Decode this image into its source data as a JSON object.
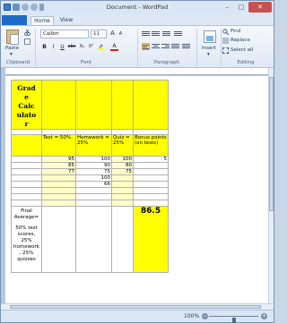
{
  "window": {
    "title": "Document - WordPad",
    "controls": {
      "minimize": "–",
      "maximize": "□",
      "close": "✕"
    }
  },
  "ribbon": {
    "tabs": {
      "file": "",
      "home": "Home",
      "view": "View"
    },
    "clipboard": {
      "paste": "Paste",
      "group": "Clipboard"
    },
    "font": {
      "family": "Calibri",
      "size": "11",
      "bold": "B",
      "italic": "I",
      "underline": "U",
      "strike": "abc",
      "sub": "X₂",
      "sup": "X²",
      "group": "Font",
      "grow": "A",
      "shrink": "A"
    },
    "paragraph": {
      "group": "Paragraph"
    },
    "insert": {
      "label": "Insert"
    },
    "editing": {
      "find": "Find",
      "replace": "Replace",
      "select_all": "Select all",
      "group": "Editing"
    }
  },
  "table": {
    "title": "Grade Calculator",
    "title_lines": [
      "Grad",
      "e",
      "Calc",
      "ulato",
      "r"
    ],
    "headers": {
      "test": "Test = 50%",
      "homework": "Homework = 25%",
      "quiz": "Quiz = 25%",
      "bonus": "Bonus points (on tests)"
    },
    "rows": [
      {
        "test": "95",
        "homework": "100",
        "quiz": "100",
        "bonus": "5"
      },
      {
        "test": "85",
        "homework": "90",
        "quiz": "80",
        "bonus": ""
      },
      {
        "test": "77",
        "homework": "75",
        "quiz": "75",
        "bonus": ""
      },
      {
        "test": "",
        "homework": "100",
        "quiz": "",
        "bonus": ""
      },
      {
        "test": "",
        "homework": "66",
        "quiz": "",
        "bonus": ""
      },
      {
        "test": "",
        "homework": "",
        "quiz": "",
        "bonus": ""
      },
      {
        "test": "",
        "homework": "",
        "quiz": "",
        "bonus": ""
      },
      {
        "test": "",
        "homework": "",
        "quiz": "",
        "bonus": ""
      }
    ],
    "final_label": "Final Average=",
    "final_note": "50% test scores, 25% homework , 25% quizzes",
    "final_value": "86.5"
  },
  "status": {
    "zoom": "100%",
    "zoom_level_percent": 100
  },
  "colors": {
    "highlight": "#ffff00",
    "light_highlight": "#ffffc8",
    "file_tab": "#1e6bc6",
    "close_button": "#c75050"
  }
}
